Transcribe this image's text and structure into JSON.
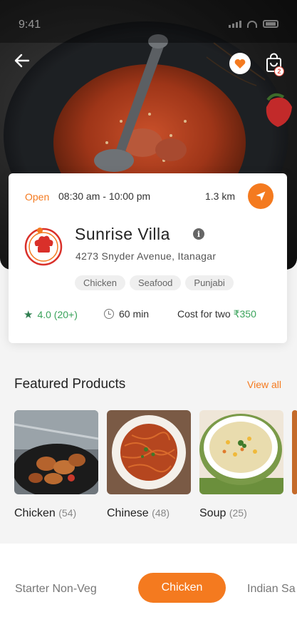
{
  "status_bar": {
    "time": "9:41"
  },
  "header": {
    "back_icon": "arrow-left-icon",
    "favorite_icon": "heart-icon",
    "cart_icon": "shopping-bag-icon",
    "cart_count": "2"
  },
  "restaurant": {
    "open_status": "Open",
    "hours": "08:30 am - 10:00 pm",
    "distance": "1.3 km",
    "name": "Sunrise Villa",
    "address": "4273 Snyder Avenue, Itanagar",
    "tags": [
      "Chicken",
      "Seafood",
      "Punjabi"
    ],
    "rating": "4.0 (20+)",
    "delivery_time": "60 min",
    "cost_label": "Cost for two",
    "cost_value": "₹350"
  },
  "featured": {
    "title": "Featured Products",
    "view_all": "View all",
    "products": [
      {
        "name": "Chicken",
        "count": "(54)"
      },
      {
        "name": "Chinese",
        "count": "(48)"
      },
      {
        "name": "Soup",
        "count": "(25)"
      }
    ]
  },
  "categories": {
    "items": [
      "Starter Non-Veg",
      "Chicken",
      "Indian Sa"
    ],
    "active": "Chicken"
  },
  "colors": {
    "accent": "#f47a1f",
    "green": "#3aa35b"
  }
}
